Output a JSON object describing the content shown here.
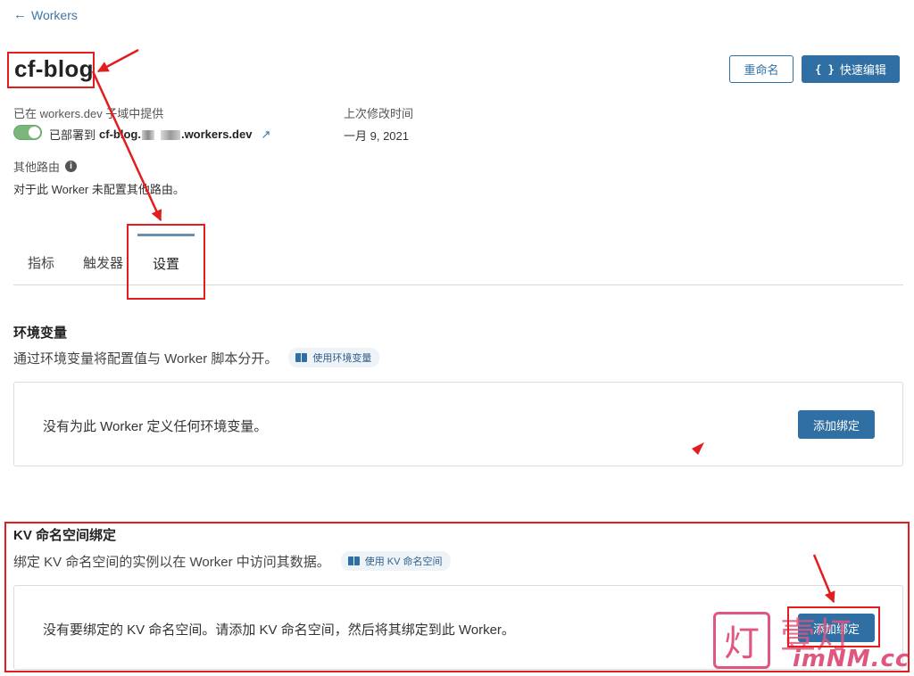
{
  "nav": {
    "back_label": "Workers"
  },
  "worker": {
    "name": "cf-blog"
  },
  "actions": {
    "rename_label": "重命名",
    "quick_edit_label": "快速编辑",
    "quick_edit_icon": "braces-icon"
  },
  "deployment": {
    "served_label": "已在 workers.dev 子域中提供",
    "enabled": true,
    "deployed_prefix": "已部署到",
    "domain_start": "cf-blog.",
    "domain_end": ".workers.dev",
    "last_modified_label": "上次修改时间",
    "last_modified_value": "一月 9, 2021"
  },
  "routes": {
    "label": "其他路由",
    "message": "对于此 Worker 未配置其他路由。"
  },
  "tabs": [
    {
      "label": "指标",
      "active": false
    },
    {
      "label": "触发器",
      "active": false
    },
    {
      "label": "设置",
      "active": true
    }
  ],
  "env_section": {
    "title": "环境变量",
    "description": "通过环境变量将配置值与 Worker 脚本分开。",
    "doc_label": "使用环境变量",
    "empty_message": "没有为此 Worker 定义任何环境变量。",
    "add_label": "添加绑定"
  },
  "kv_section": {
    "title": "KV 命名空间绑定",
    "description": "绑定 KV 命名空间的实例以在 Worker 中访问其数据。",
    "doc_label": "使用 KV 命名空间",
    "empty_message": "没有要绑定的 KV 命名空间。请添加 KV 命名空间，然后将其绑定到此 Worker。",
    "add_label": "添加绑定"
  },
  "watermark": {
    "glyph": "灯",
    "text": "壹灯",
    "url": "imNM.cc"
  },
  "colors": {
    "primary": "#2f6fa3",
    "annotation": "#e11d1d",
    "watermark": "#e0567e"
  }
}
